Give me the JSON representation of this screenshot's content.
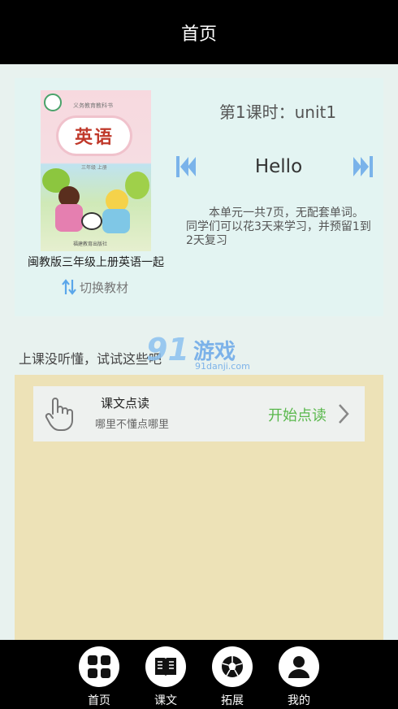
{
  "header": {
    "title": "首页"
  },
  "book": {
    "cover": {
      "series": "义务教育教科书",
      "title": "英语",
      "grade": "三年级 上册",
      "publisher": "福建教育出版社"
    },
    "name": "闽教版三年级上册英语一起",
    "switch_label": "切换教材"
  },
  "lesson": {
    "title": "第1课时：unit1",
    "word": "Hello",
    "description": "本单元一共7页，无配套单词。同学们可以花3天来学习，并预留1到2天复习"
  },
  "hint": "上课没听懂，试试这些吧",
  "watermark": {
    "number": "91",
    "text": "游戏",
    "url": "91danji.com"
  },
  "reading": {
    "title": "课文点读",
    "subtitle": "哪里不懂点哪里",
    "action": "开始点读"
  },
  "tabs": [
    {
      "label": "首页",
      "icon": "grid-icon"
    },
    {
      "label": "课文",
      "icon": "book-icon"
    },
    {
      "label": "拓展",
      "icon": "ball-icon"
    },
    {
      "label": "我的",
      "icon": "user-icon"
    }
  ],
  "colors": {
    "background": "#e8f2ef",
    "card": "#e3f4f2",
    "panel": "#ede2b7",
    "accent_green": "#5ab84d",
    "nav_blue": "#7ab3ea"
  }
}
